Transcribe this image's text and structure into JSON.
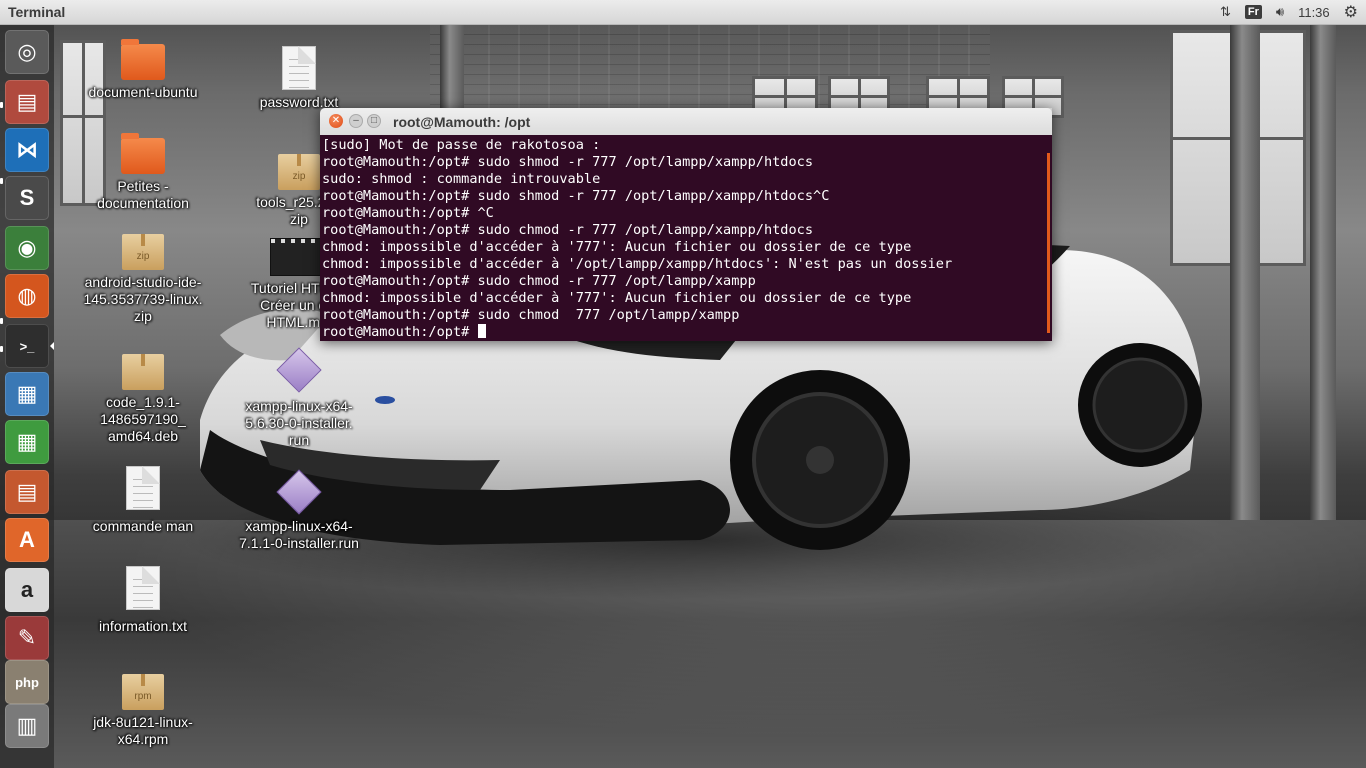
{
  "top_panel": {
    "app_title": "Terminal",
    "keyboard_layout": "Fr",
    "clock": "11:36"
  },
  "launcher": {
    "items": [
      {
        "name": "dash-home",
        "icon": "ubuntu-logo-icon",
        "glyph": "◎",
        "bg": "#5a5a5a"
      },
      {
        "name": "files",
        "icon": "file-cabinet-icon",
        "glyph": "▤",
        "bg": "#b04a3e"
      },
      {
        "name": "visual-studio-code",
        "icon": "vscode-icon",
        "glyph": "⋈",
        "bg": "#1e6fb8"
      },
      {
        "name": "sublime-text",
        "icon": "sublime-icon",
        "glyph": "S",
        "bg": "#4a4a4a"
      },
      {
        "name": "chrome",
        "icon": "chrome-icon",
        "glyph": "◉",
        "bg": "#3b7f3b"
      },
      {
        "name": "firefox",
        "icon": "firefox-icon",
        "glyph": "◍",
        "bg": "#d4561e"
      },
      {
        "name": "terminal",
        "icon": "terminal-icon",
        "glyph": ">_",
        "bg": "#2e2e2e"
      },
      {
        "name": "libreoffice-impress",
        "icon": "presentation-icon",
        "glyph": "▦",
        "bg": "#3a78b5"
      },
      {
        "name": "libreoffice-calc",
        "icon": "spreadsheet-icon",
        "glyph": "▦",
        "bg": "#3f9b3f"
      },
      {
        "name": "libreoffice-writer",
        "icon": "document-icon",
        "glyph": "▤",
        "bg": "#c4582f"
      },
      {
        "name": "ubuntu-software",
        "icon": "software-center-icon",
        "glyph": "A",
        "bg": "#e0662a"
      },
      {
        "name": "amazon",
        "icon": "amazon-icon",
        "glyph": "a",
        "bg": "#d8d8d8"
      },
      {
        "name": "system-settings",
        "icon": "settings-icon",
        "glyph": "✎",
        "bg": "#9a3a3a"
      },
      {
        "name": "phpmyadmin",
        "icon": "php-icon",
        "glyph": "php",
        "bg": "#8a8070"
      },
      {
        "name": "workspace-switcher",
        "icon": "workspace-icon",
        "glyph": "▥",
        "bg": "#7a7a7a"
      }
    ]
  },
  "desktop": {
    "icons": [
      {
        "label": "document-ubuntu",
        "icon": "folder-icon"
      },
      {
        "label": "password.txt",
        "icon": "text-file-icon"
      },
      {
        "label": "Petites - documentation",
        "icon": "folder-icon"
      },
      {
        "label": "tools_r25.2.3-\nzip",
        "icon": "zip-archive-icon",
        "tag": "zip"
      },
      {
        "label": "android-studio-ide-\n145.3537739-linux.\nzip",
        "icon": "zip-archive-icon",
        "tag": "zip"
      },
      {
        "label": "Tutoriel HTML -\nCréer un e...\nHTML.m...",
        "icon": "video-file-icon"
      },
      {
        "label": "code_1.9.1-\n1486597190_\namd64.deb",
        "icon": "deb-package-icon"
      },
      {
        "label": "xampp-linux-x64-\n5.6.30-0-installer.\nrun",
        "icon": "installer-icon"
      },
      {
        "label": "commande man",
        "icon": "text-file-icon"
      },
      {
        "label": "xampp-linux-x64-\n7.1.1-0-installer.run",
        "icon": "installer-icon"
      },
      {
        "label": "information.txt",
        "icon": "text-file-icon"
      },
      {
        "label": "jdk-8u121-linux-\nx64.rpm",
        "icon": "rpm-package-icon",
        "tag": "rpm"
      }
    ]
  },
  "terminal": {
    "title": "root@Mamouth: /opt",
    "lines": [
      "[sudo] Mot de passe de rakotosoa :",
      "root@Mamouth:/opt# sudo shmod -r 777 /opt/lampp/xampp/htdocs",
      "sudo: shmod : commande introuvable",
      "root@Mamouth:/opt# sudo shmod -r 777 /opt/lampp/xampp/htdocs^C",
      "root@Mamouth:/opt# ^C",
      "root@Mamouth:/opt# sudo chmod -r 777 /opt/lampp/xampp/htdocs",
      "chmod: impossible d'accéder à '777': Aucun fichier ou dossier de ce type",
      "chmod: impossible d'accéder à '/opt/lampp/xampp/htdocs': N'est pas un dossier",
      "root@Mamouth:/opt# sudo chmod -r 777 /opt/lampp/xampp",
      "chmod: impossible d'accéder à '777': Aucun fichier ou dossier de ce type",
      "root@Mamouth:/opt# sudo chmod  777 /opt/lampp/xampp"
    ],
    "prompt": "root@Mamouth:/opt# "
  },
  "colors": {
    "terminal_bg": "#300a24",
    "close_button": "#df4b16",
    "launcher_bg": "#282828"
  }
}
